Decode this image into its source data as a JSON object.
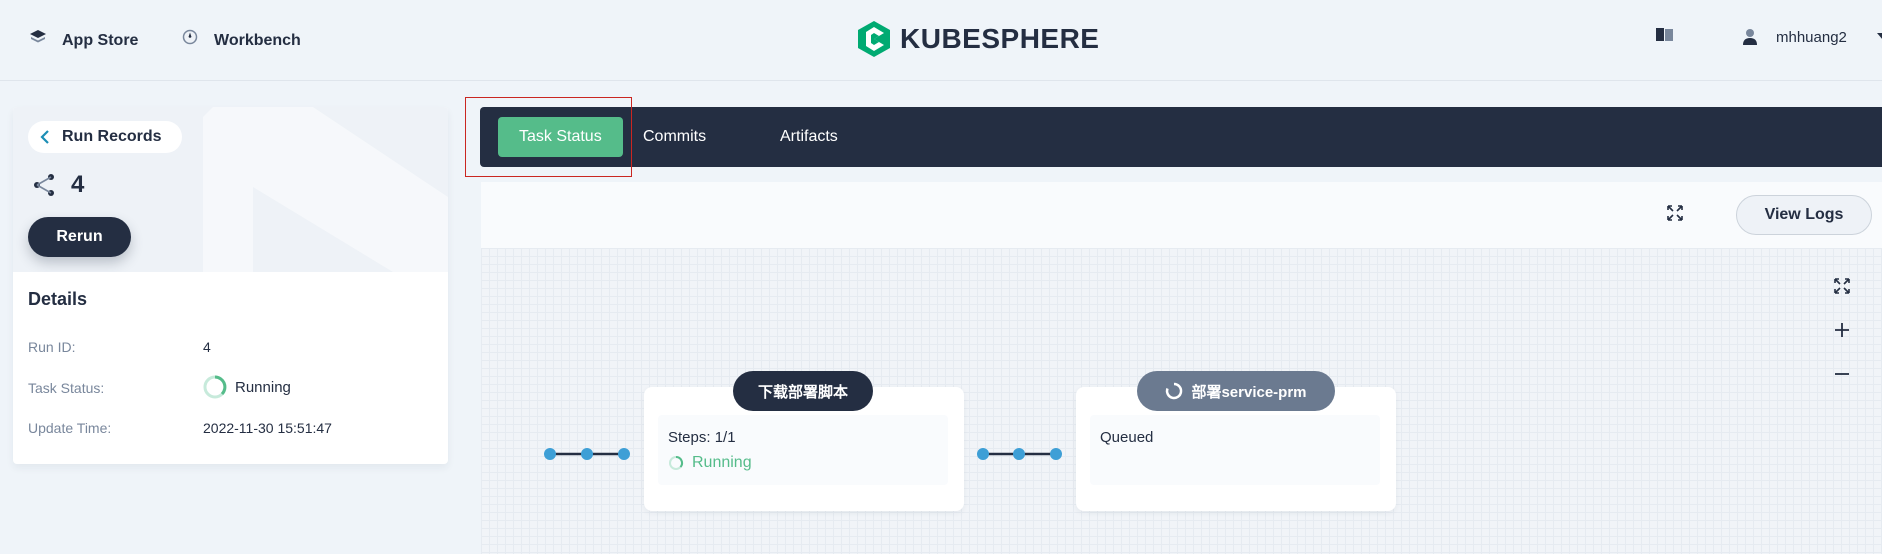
{
  "header": {
    "app_store": "App Store",
    "workbench": "Workbench",
    "logo_text": "KUBESPHERE",
    "username": "mhhuang2"
  },
  "run": {
    "back_label": "Run Records",
    "run_number": "4",
    "rerun_label": "Rerun"
  },
  "details": {
    "title": "Details",
    "rows": [
      {
        "label": "Run ID:",
        "value": "4"
      },
      {
        "label": "Task Status:",
        "value": "Running"
      },
      {
        "label": "Update Time:",
        "value": "2022-11-30 15:51:47"
      }
    ]
  },
  "tabs": [
    {
      "label": "Task Status",
      "active": true
    },
    {
      "label": "Commits",
      "active": false
    },
    {
      "label": "Artifacts",
      "active": false
    }
  ],
  "toolbar": {
    "view_logs": "View Logs"
  },
  "stages": [
    {
      "name": "下载部署脚本",
      "steps_label": "Steps: 1/1",
      "status": "Running"
    },
    {
      "name": "部署service-prm",
      "status": "Queued"
    }
  ],
  "colors": {
    "accent": "#55bc8a",
    "dark": "#242e42",
    "node": "#3e9fd6",
    "queued_pill": "#6b7a90",
    "highlight": "#ca2621"
  }
}
